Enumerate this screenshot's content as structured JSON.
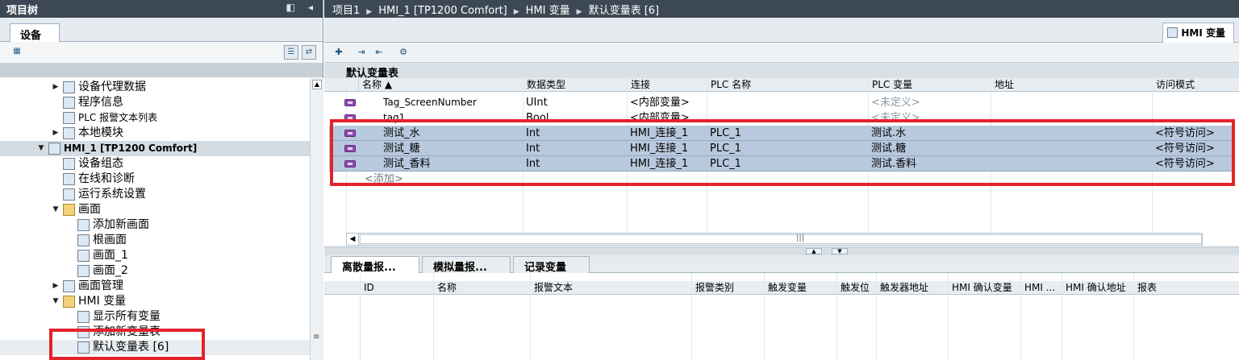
{
  "left": {
    "title": "项目树",
    "controls": "◧ ◂",
    "tab": "设备",
    "tree": [
      {
        "label": "设备代理数据",
        "indent": 1,
        "arrow": "right",
        "icon": "proxy-data-icon"
      },
      {
        "label": "程序信息",
        "indent": 1,
        "arrow": "",
        "icon": "program-info-icon"
      },
      {
        "label": "PLC 报警文本列表",
        "indent": 1,
        "arrow": "",
        "icon": "alarm-text-list-icon"
      },
      {
        "label": "本地模块",
        "indent": 1,
        "arrow": "right",
        "icon": "local-modules-icon"
      },
      {
        "label": "HMI_1 [TP1200 Comfort]",
        "indent": 0,
        "arrow": "down",
        "icon": "hmi-device-icon"
      },
      {
        "label": "设备组态",
        "indent": 1,
        "arrow": "",
        "icon": "device-config-icon"
      },
      {
        "label": "在线和诊断",
        "indent": 1,
        "arrow": "",
        "icon": "online-diagnostics-icon"
      },
      {
        "label": "运行系统设置",
        "indent": 1,
        "arrow": "",
        "icon": "runtime-settings-icon"
      },
      {
        "label": "画面",
        "indent": 1,
        "arrow": "down",
        "icon": "folder-icon"
      },
      {
        "label": "添加新画面",
        "indent": 2,
        "arrow": "",
        "icon": "add-screen-icon"
      },
      {
        "label": "根画面",
        "indent": 2,
        "arrow": "",
        "icon": "screen-icon"
      },
      {
        "label": "画面_1",
        "indent": 2,
        "arrow": "",
        "icon": "screen-icon"
      },
      {
        "label": "画面_2",
        "indent": 2,
        "arrow": "",
        "icon": "screen-icon"
      },
      {
        "label": "画面管理",
        "indent": 1,
        "arrow": "right",
        "icon": "screen-management-icon"
      },
      {
        "label": "HMI 变量",
        "indent": 1,
        "arrow": "down",
        "icon": "folder-icon"
      },
      {
        "label": "显示所有变量",
        "indent": 2,
        "arrow": "",
        "icon": "show-all-tags-icon"
      },
      {
        "label": "添加新变量表",
        "indent": 2,
        "arrow": "",
        "icon": "add-tag-table-icon"
      },
      {
        "label": "默认变量表 [6]",
        "indent": 2,
        "arrow": "",
        "icon": "tag-table-icon"
      }
    ]
  },
  "breadcrumb": [
    "项目1",
    "HMI_1 [TP1200 Comfort]",
    "HMI 变量",
    "默认变量表 [6]"
  ],
  "right_tab": "HMI 变量",
  "table_title": "默认变量表",
  "columns": [
    "名称 ▲",
    "数据类型",
    "连接",
    "PLC 名称",
    "PLC 变量",
    "地址",
    "访问模式"
  ],
  "rows": [
    {
      "name": "Tag_ScreenNumber",
      "type": "UInt",
      "conn": "<内部变量>",
      "plc": "",
      "plcvar": "<未定义>",
      "addr": "",
      "access": "",
      "hl": false
    },
    {
      "name": "tag1",
      "type": "Bool",
      "conn": "<内部变量>",
      "plc": "",
      "plcvar": "<未定义>",
      "addr": "",
      "access": "",
      "hl": false
    },
    {
      "name": "测试_水",
      "type": "Int",
      "conn": "HMI_连接_1",
      "plc": "PLC_1",
      "plcvar": "测试.水",
      "addr": "",
      "access": "<符号访问>",
      "hl": true
    },
    {
      "name": "测试_糖",
      "type": "Int",
      "conn": "HMI_连接_1",
      "plc": "PLC_1",
      "plcvar": "测试.糖",
      "addr": "",
      "access": "<符号访问>",
      "hl": true
    },
    {
      "name": "测试_香料",
      "type": "Int",
      "conn": "HMI_连接_1",
      "plc": "PLC_1",
      "plcvar": "测试.香料",
      "addr": "",
      "access": "<符号访问>",
      "hl": true
    }
  ],
  "add_row": "<添加>",
  "bottom_tabs": [
    "离散量报...",
    "模拟量报...",
    "记录变量"
  ],
  "alarm_columns": [
    "ID",
    "名称",
    "报警文本",
    "报警类别",
    "触发变量",
    "触发位",
    "触发器地址",
    "HMI 确认变量",
    "HMI ...",
    "HMI 确认地址",
    "报表"
  ],
  "colors": {
    "highlight": "#b8c8dd",
    "annotation": "#e3232b",
    "titlebar": "#3c4955"
  }
}
